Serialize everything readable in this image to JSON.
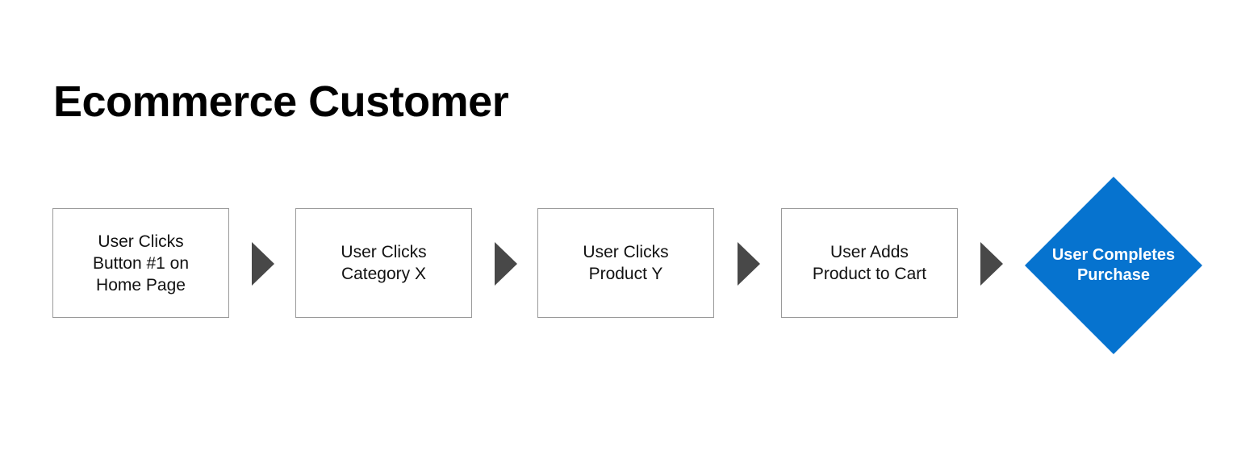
{
  "title": "Ecommerce Customer",
  "colors": {
    "accent": "#0673cf",
    "arrow": "#484848",
    "box_border": "#9a9a9a"
  },
  "steps": [
    {
      "label": "User Clicks\nButton #1 on\nHome Page"
    },
    {
      "label": "User Clicks\nCategory X"
    },
    {
      "label": "User Clicks\nProduct Y"
    },
    {
      "label": "User Adds\nProduct to Cart"
    }
  ],
  "final": {
    "label": "User Completes\nPurchase"
  },
  "arrows": [
    "arrow-right-icon",
    "arrow-right-icon",
    "arrow-right-icon",
    "arrow-right-icon"
  ]
}
